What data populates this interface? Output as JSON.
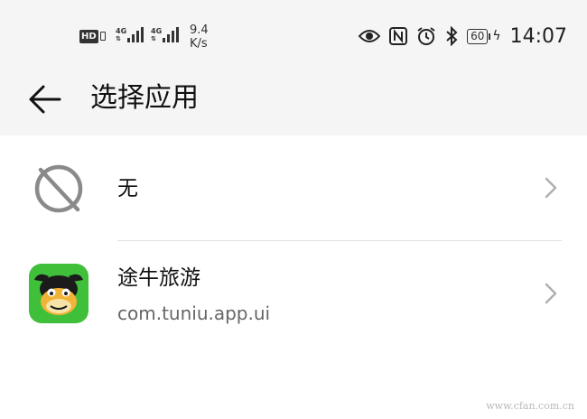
{
  "status_bar": {
    "hd_label": "HD",
    "net1_label": "4G",
    "net2_label": "4G",
    "speed_value": "9.4",
    "speed_unit": "K/s",
    "battery": "60",
    "time": "14:07",
    "icons": [
      "eye-icon",
      "nfc-icon",
      "alarm-icon",
      "bluetooth-icon",
      "battery-icon",
      "charging-icon"
    ]
  },
  "header": {
    "back_icon": "back-arrow-icon",
    "title": "选择应用"
  },
  "list": {
    "items": [
      {
        "label": "无",
        "icon": "none-icon"
      },
      {
        "label": "途牛旅游",
        "package": "com.tuniu.app.ui",
        "icon": "tuniu-app-icon"
      }
    ]
  },
  "watermark": "www.cfan.com.cn",
  "colors": {
    "header_bg": "#f5f5f5",
    "tuniu_green": "#3fbf3a",
    "divider": "#e0e0e0",
    "chevron": "#b0b0b0"
  }
}
